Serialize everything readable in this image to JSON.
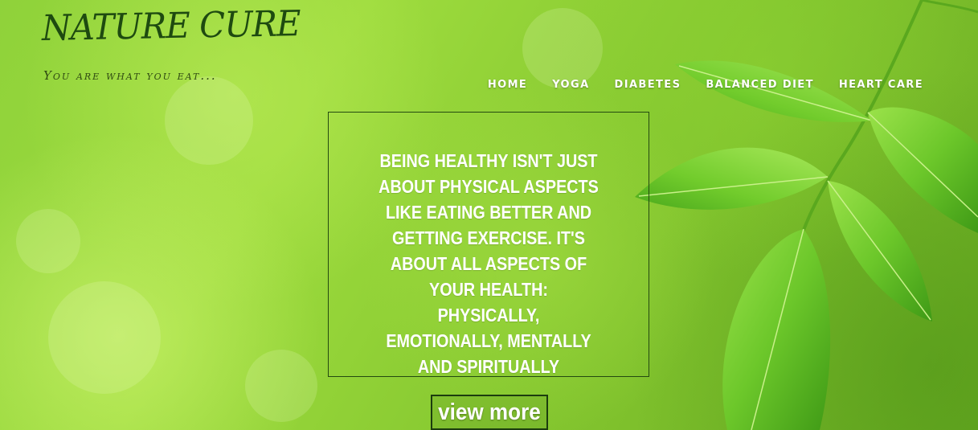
{
  "site": {
    "title": "NATURE CURE",
    "tagline": "You are what you eat..."
  },
  "nav": {
    "items": [
      {
        "label": "HOME"
      },
      {
        "label": "YOGA"
      },
      {
        "label": "DIABETES"
      },
      {
        "label": "BALANCED DIET"
      },
      {
        "label": "HEART CARE"
      }
    ]
  },
  "hero": {
    "quote": "BEING HEALTHY ISN'T JUST ABOUT PHYSICAL ASPECTS LIKE EATING BETTER AND GETTING EXERCISE. IT'S ABOUT ALL ASPECTS OF YOUR HEALTH: PHYSICALLY, EMOTIONALLY, MENTALLY AND SPIRITUALLY",
    "button_label": "view more",
    "background_image": "green-leaves-bokeh"
  },
  "colors": {
    "background": "#8fd23a",
    "title": "#1e4a10",
    "leaf": "#6cc72a",
    "box_border": "#244a10",
    "text_light": "#ffffff"
  }
}
